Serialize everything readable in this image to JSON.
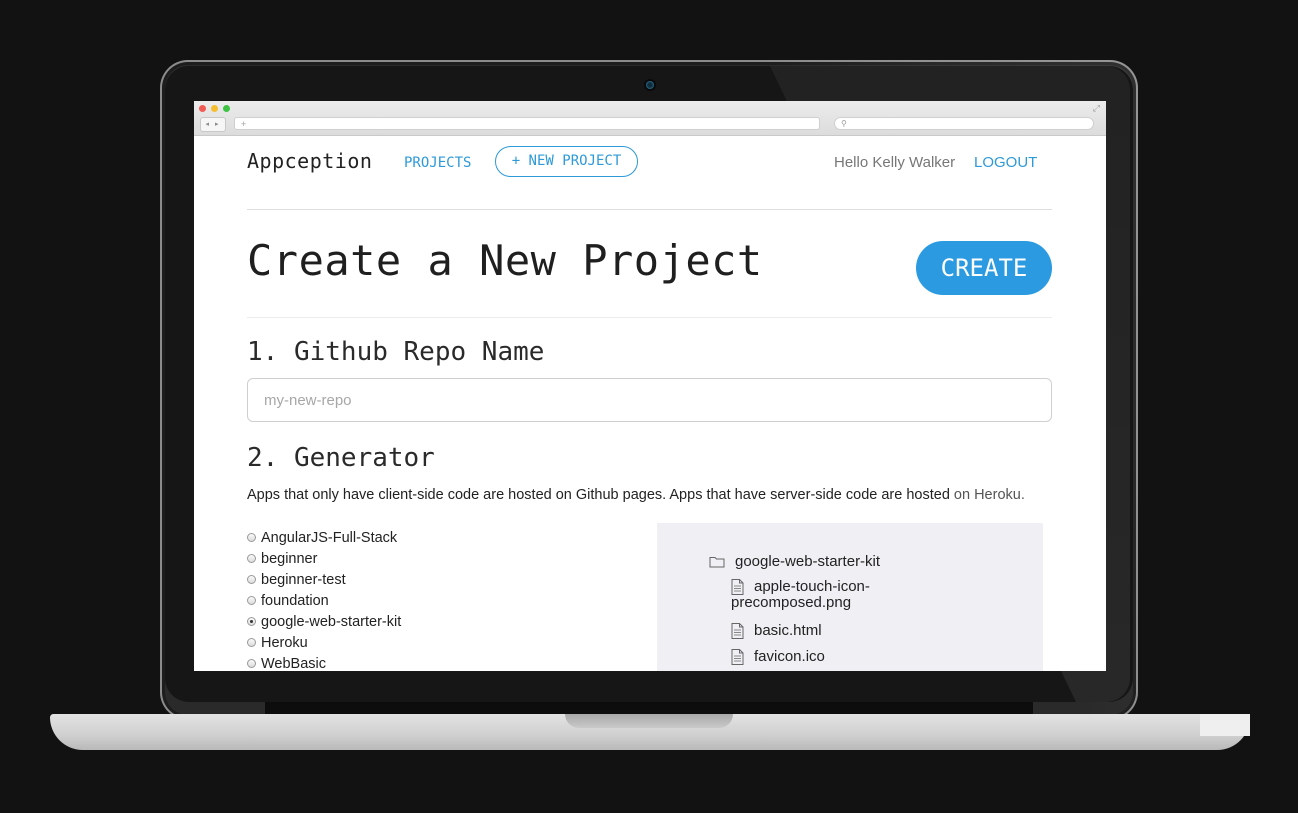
{
  "browser": {
    "url_placeholder": "+",
    "search_placeholder": "⚲",
    "nav_arrows": "◂ ▸",
    "expand": "⤢"
  },
  "header": {
    "brand": "Appception",
    "projects_link": "PROJECTS",
    "new_project_button": "+ NEW PROJECT",
    "greeting": "Hello Kelly Walker",
    "logout_link": "LOGOUT"
  },
  "main": {
    "title": "Create a New Project",
    "create_button": "CREATE",
    "section1": {
      "heading": "1. Github Repo Name",
      "input_placeholder": "my-new-repo",
      "input_value": ""
    },
    "section2": {
      "heading": "2. Generator",
      "description": "Apps that only have client-side code are hosted on Github pages. Apps that have server-side code are hosted ",
      "description_link": "on Heroku.",
      "generators": [
        {
          "label": "AngularJS-Full-Stack",
          "checked": false
        },
        {
          "label": "beginner",
          "checked": false
        },
        {
          "label": "beginner-test",
          "checked": false
        },
        {
          "label": "foundation",
          "checked": false
        },
        {
          "label": "google-web-starter-kit",
          "checked": true
        },
        {
          "label": "Heroku",
          "checked": false
        },
        {
          "label": "WebBasic",
          "checked": false
        }
      ],
      "file_tree": {
        "root": "google-web-starter-kit",
        "files": [
          "apple-touch-icon-\nprecomposed.png",
          "basic.html",
          "favicon.ico"
        ]
      }
    }
  },
  "colors": {
    "accent": "#2e9ad8",
    "create_button": "#2b9ae0",
    "tree_background": "#f0f0f4"
  }
}
